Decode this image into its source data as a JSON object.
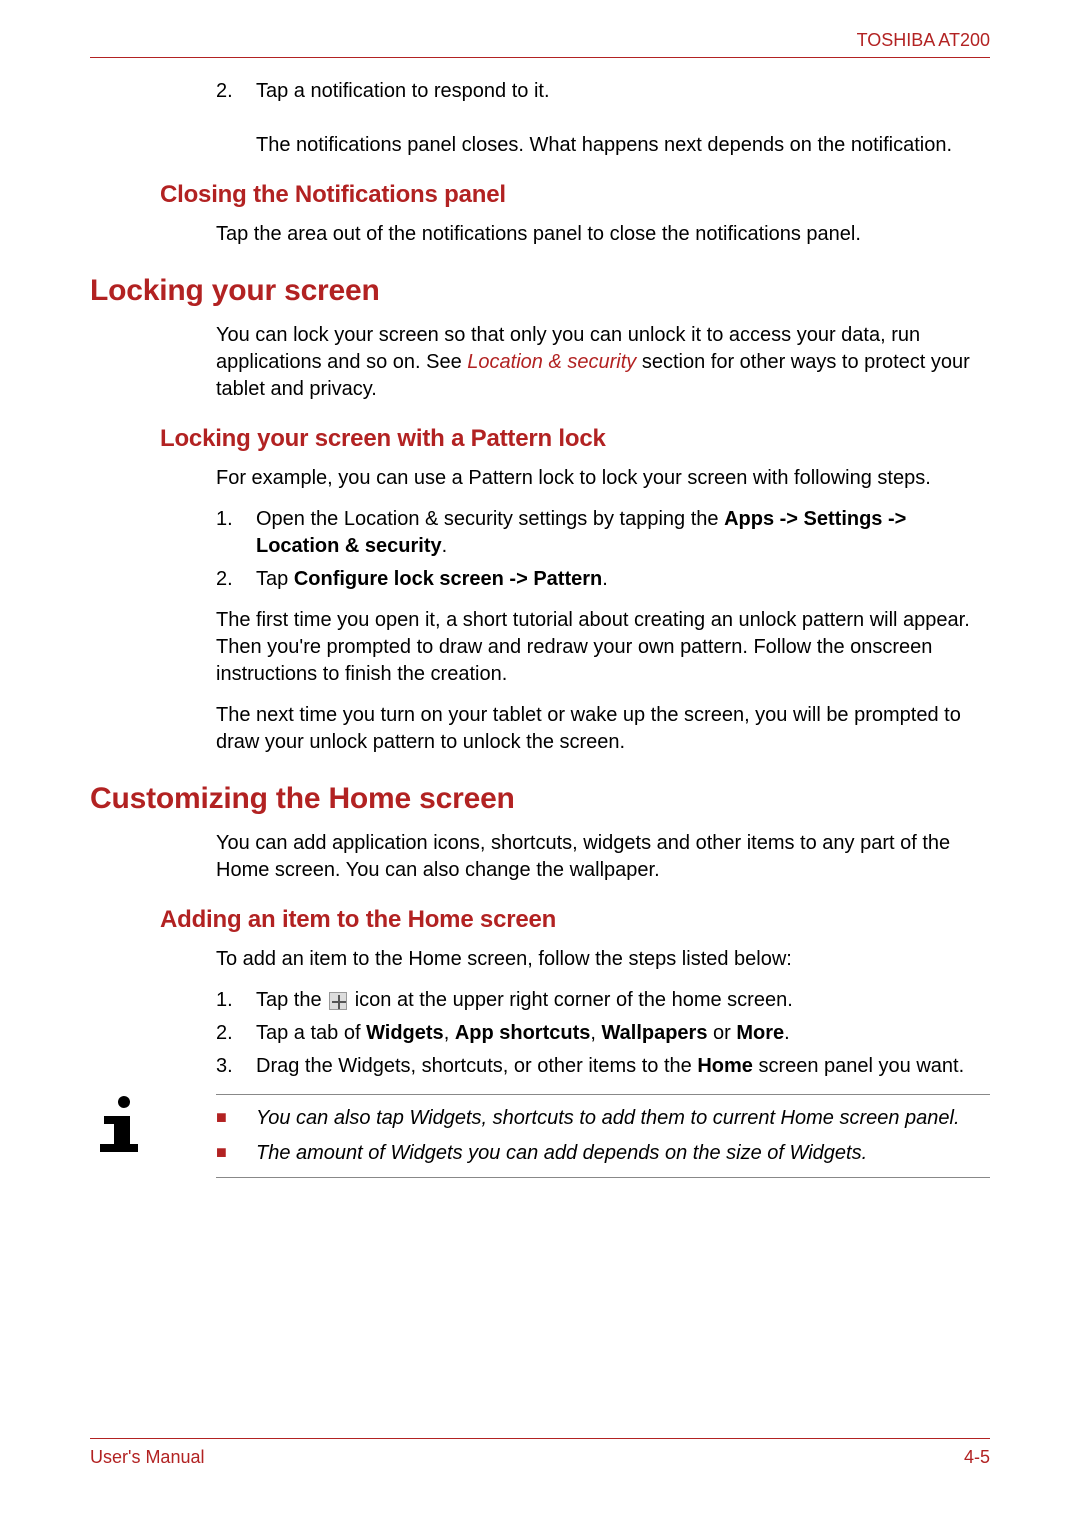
{
  "header": {
    "product": "TOSHIBA AT200"
  },
  "footer": {
    "left": "User's Manual",
    "right": "4-5"
  },
  "top_list": {
    "step2_num": "2.",
    "step2_a": "Tap a notification to respond to it.",
    "step2_b": "The notifications panel closes. What happens next depends on the notification."
  },
  "closing": {
    "heading": "Closing the Notifications panel",
    "p1": "Tap the area out of the notifications panel to close the notifications panel."
  },
  "locking": {
    "heading": "Locking your screen",
    "p1_a": "You can lock your screen so that only you can unlock it to access your data, run applications and so on. See ",
    "p1_link": "Location & security",
    "p1_b": " section for other ways to protect your tablet and privacy.",
    "sub_heading": "Locking your screen with a Pattern lock",
    "p2": "For example, you can use a Pattern lock to lock your screen with following steps.",
    "step1_num": "1.",
    "step1_a": "Open the Location & security settings by tapping the ",
    "step1_b": "Apps -> Settings -> Location & security",
    "step1_c": ".",
    "step2_num": "2.",
    "step2_a": "Tap ",
    "step2_b": "Configure lock screen -> Pattern",
    "step2_c": ".",
    "p3": "The first time you open it, a short tutorial about creating an unlock pattern will appear. Then you're prompted to draw and redraw your own pattern. Follow the onscreen instructions to finish the creation.",
    "p4": "The next time you turn on your tablet or wake up the screen, you will be prompted to draw your unlock pattern to unlock the screen."
  },
  "custom": {
    "heading": "Customizing the Home screen",
    "p1": "You can add application icons, shortcuts, widgets and other items to any part of the Home screen. You can also change the wallpaper.",
    "sub_heading": "Adding an item to the Home screen",
    "p2": "To add an item to the Home screen, follow the steps listed below:",
    "s1_num": "1.",
    "s1_a": "Tap the ",
    "s1_b": " icon at the upper right corner of the home screen.",
    "s2_num": "2.",
    "s2_a": "Tap a tab of ",
    "s2_b": "Widgets",
    "s2_c": ", ",
    "s2_d": "App shortcuts",
    "s2_e": ", ",
    "s2_f": "Wallpapers",
    "s2_g": " or ",
    "s2_h": "More",
    "s2_i": ".",
    "s3_num": "3.",
    "s3_a": "Drag the Widgets, shortcuts, or other items to the ",
    "s3_b": "Home",
    "s3_c": " screen panel you want.",
    "note1": "You can also tap Widgets, shortcuts to add them to current Home screen panel.",
    "note2": "The amount of Widgets you can add depends on the size of Widgets."
  }
}
